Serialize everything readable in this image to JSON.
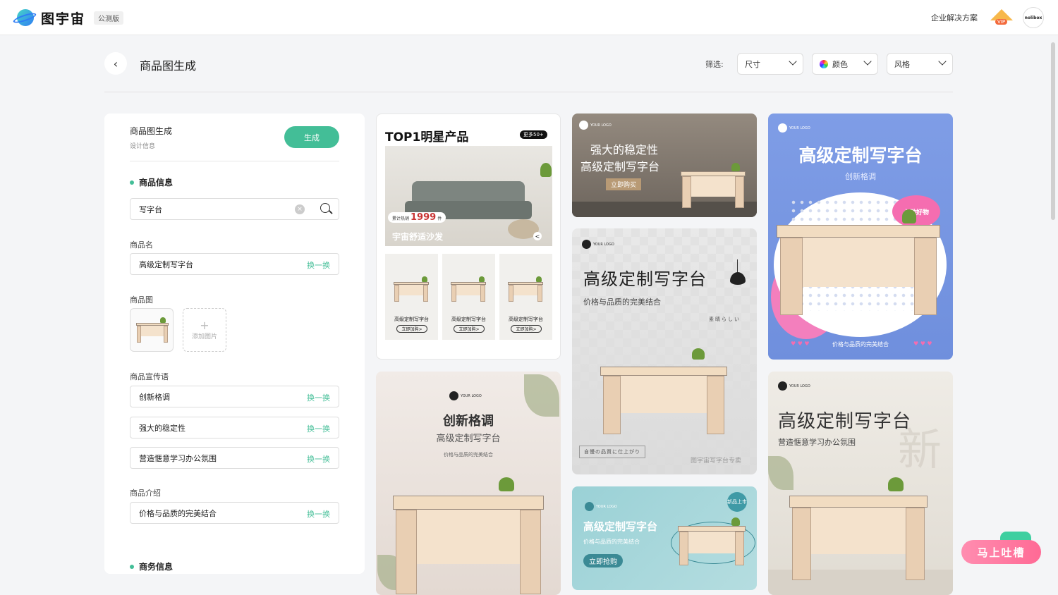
{
  "app": {
    "name": "图宇宙",
    "badge": "公测版",
    "enterprise": "企业解决方案",
    "vip_label": "VIP",
    "avatar_text": "nolibox"
  },
  "page": {
    "title": "商品图生成",
    "filter_label": "筛选:",
    "filters": [
      "尺寸",
      "颜色",
      "风格"
    ]
  },
  "panel": {
    "title": "商品图生成",
    "subtitle": "设计信息",
    "generate_label": "生成",
    "section_product": "商品信息",
    "search_value": "写字台",
    "name_label": "商品名",
    "name_value": "高级定制写字台",
    "swap_label": "换一换",
    "image_label": "商品图",
    "add_image_label": "添加图片",
    "slogan_label": "商品宣传语",
    "slogans": [
      "创新格调",
      "强大的稳定性",
      "营造惬意学习办公氛围"
    ],
    "intro_label": "商品介绍",
    "intro_value": "价格与品质的完美结合",
    "section_business": "商务信息"
  },
  "cards": {
    "c1": {
      "title": "TOP1明星产品",
      "more": "更多50+",
      "badge_prefix": "累计热销",
      "badge_num": "1999",
      "badge_unit": "件",
      "sub": "宇宙舒适沙发",
      "item_name": "高级定制写字台",
      "item_buy": "立即加购>"
    },
    "c2": {
      "logo": "YOUR LOGO",
      "t1": "强大的稳定性",
      "t2": "高级定制写字台",
      "buy": "立即购买"
    },
    "c3": {
      "logo": "YOUR LOGO",
      "t1": "高级定制写字台",
      "t2": "价格与品质的完美结合",
      "jp1": "素晴らしい",
      "jp2": "自慢の品質に仕上がり",
      "foot": "图宇宙写字台专卖"
    },
    "c4": {
      "logo": "YOUR LOGO",
      "t1": "高级定制写字台",
      "t2": "价格与品质的完美结合",
      "buy": "立即抢购",
      "badge": "新品上市"
    },
    "c5": {
      "logo": "YOUR LOGO",
      "t1": "创新格调",
      "t2": "高级定制写字台",
      "t3": "价格与品质的完美结合"
    },
    "c6": {
      "logo": "YOUR LOGO",
      "t1": "高级定制写字台",
      "t2": "创新格调",
      "burst": "心动好物",
      "foot": "价格与品质的完美结合"
    },
    "c7": {
      "logo": "YOUR LOGO",
      "t1": "高级定制写字台",
      "t2": "营造惬意学习办公氛围",
      "big": "新"
    }
  },
  "feedback": "马上吐槽",
  "colors": {
    "accent": "#43be97",
    "pink": "#ff6a95",
    "blue_card": "#7f9de6"
  }
}
